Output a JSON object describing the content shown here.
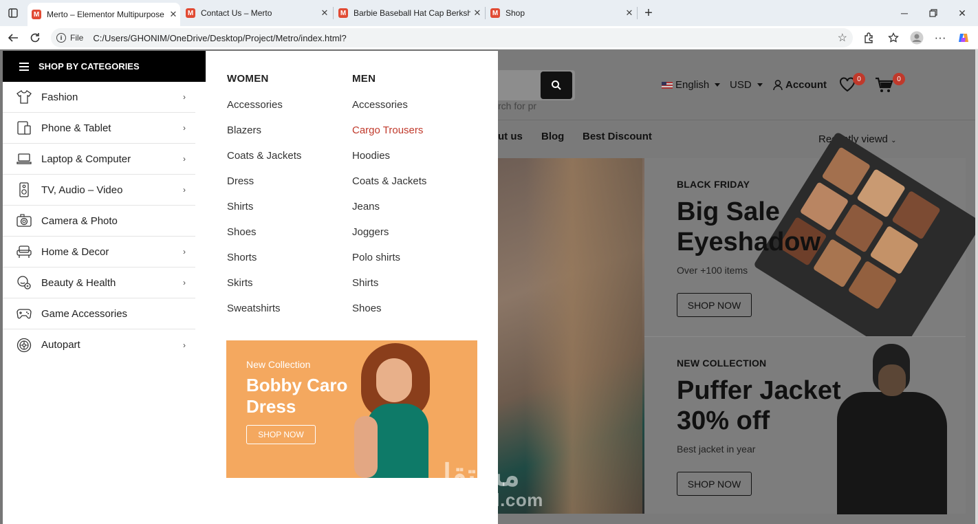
{
  "browser": {
    "tabs": [
      {
        "title": "Merto – Elementor Multipurpose",
        "active": true
      },
      {
        "title": "Contact Us – Merto",
        "active": false
      },
      {
        "title": "Barbie Baseball Hat Cap Berkshire",
        "active": false
      },
      {
        "title": "Shop",
        "active": false
      }
    ],
    "url_label": "File",
    "url": "C:/Users/GHONIM/OneDrive/Desktop/Project/Metro/index.html?"
  },
  "sidebar": {
    "title": "SHOP BY CATEGORIES",
    "items": [
      {
        "label": "Fashion",
        "icon": "tshirt-icon",
        "has_sub": true
      },
      {
        "label": "Phone & Tablet",
        "icon": "tablet-icon",
        "has_sub": true
      },
      {
        "label": "Laptop & Computer",
        "icon": "laptop-icon",
        "has_sub": true
      },
      {
        "label": "TV, Audio – Video",
        "icon": "speaker-icon",
        "has_sub": true
      },
      {
        "label": "Camera & Photo",
        "icon": "camera-icon",
        "has_sub": false
      },
      {
        "label": "Home & Decor",
        "icon": "sofa-icon",
        "has_sub": true
      },
      {
        "label": "Beauty & Health",
        "icon": "beauty-icon",
        "has_sub": true
      },
      {
        "label": "Game Accessories",
        "icon": "gamepad-icon",
        "has_sub": false
      },
      {
        "label": "Autopart",
        "icon": "wheel-icon",
        "has_sub": true
      }
    ]
  },
  "mega_menu": {
    "women": {
      "heading": "WOMEN",
      "links": [
        "Accessories",
        "Blazers",
        "Coats & Jackets",
        "Dress",
        "Shirts",
        "Shoes",
        "Shorts",
        "Skirts",
        "Sweatshirts"
      ]
    },
    "men": {
      "heading": "MEN",
      "links": [
        "Accessories",
        "Cargo Trousers",
        "Hoodies",
        "Coats & Jackets",
        "Jeans",
        "Joggers",
        "Polo shirts",
        "Shirts",
        "Shoes"
      ],
      "highlighted": "Cargo Trousers"
    },
    "promo": {
      "tag": "New Collection",
      "title": "Bobby Caro Dress",
      "button": "SHOP NOW"
    }
  },
  "header": {
    "search_placeholder": "rch for pr",
    "language": "English",
    "currency": "USD",
    "account": "Account",
    "wishlist_count": "0",
    "cart_count": "0",
    "nav": [
      "ut us",
      "Blog",
      "Best Discount"
    ],
    "recently_viewed": "Recently viewd"
  },
  "banners": [
    {
      "eyebrow": "BLACK FRIDAY",
      "title_line1": "Big Sale",
      "title_line2": "Eyeshadow",
      "subtitle": "Over +100 items",
      "button": "SHOP NOW"
    },
    {
      "eyebrow": "NEW COLLECTION",
      "title_line1": "Puffer Jacket",
      "title_line2": "30% off",
      "subtitle": "Best jacket in year",
      "button": "SHOP NOW"
    }
  ],
  "watermark": {
    "arabic": "مستقل",
    "latin": "mostaql.com"
  }
}
